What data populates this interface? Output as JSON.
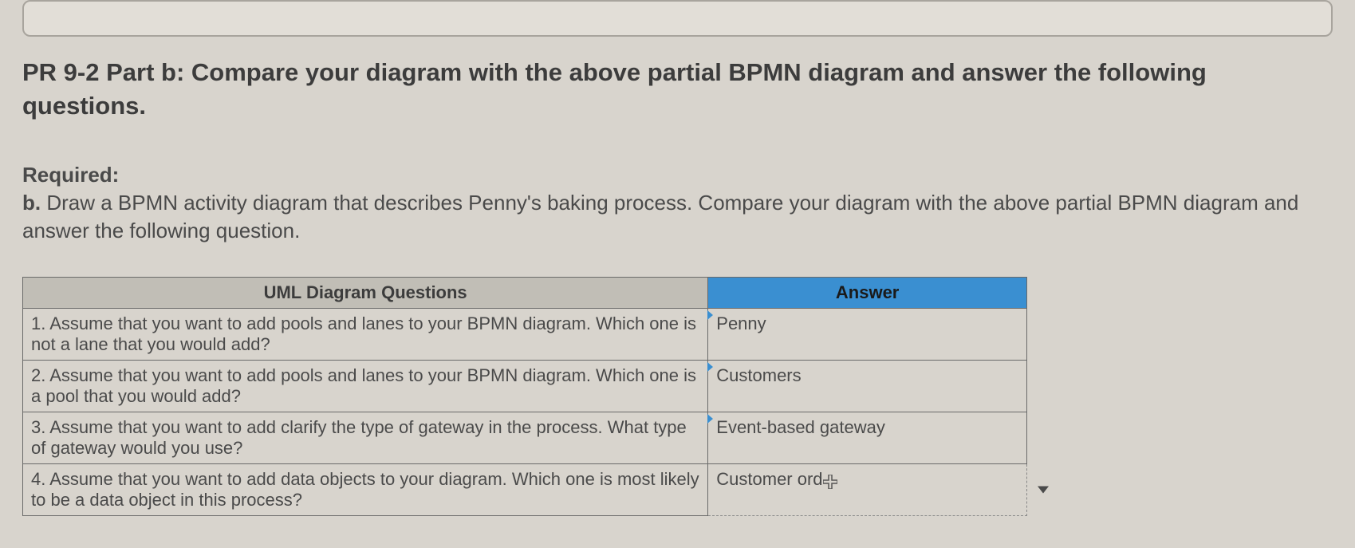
{
  "title": "PR 9-2 Part b: Compare your diagram with the above partial BPMN diagram and answer the following questions.",
  "required": {
    "label": "Required:",
    "b_label": "b.",
    "text": " Draw a BPMN activity diagram that describes Penny's baking process. Compare your diagram with the above partial BPMN diagram and answer the following question."
  },
  "table": {
    "headers": {
      "questions": "UML Diagram Questions",
      "answer": "Answer"
    },
    "rows": [
      {
        "q": "1. Assume that you want to add pools and lanes to your BPMN diagram. Which one is not a lane that you would add?",
        "a": "Penny"
      },
      {
        "q": "2. Assume that you want to add pools and lanes to your BPMN diagram. Which one is a pool that you would add?",
        "a": "Customers"
      },
      {
        "q": "3. Assume that you want to add clarify the type of gateway in the process. What type of gateway would you use?",
        "a": "Event-based gateway"
      },
      {
        "q": "4. Assume that you want to add data objects to your diagram. Which one is most likely to be a data object in this process?",
        "a": "Customer ord"
      }
    ]
  }
}
